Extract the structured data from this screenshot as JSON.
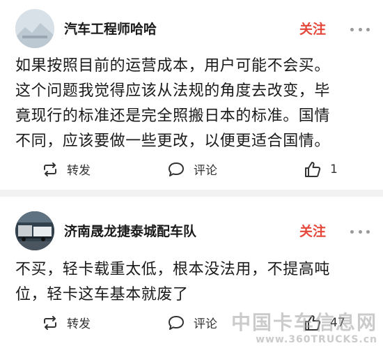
{
  "posts": [
    {
      "username": "汽车工程师哈哈",
      "follow_label": "关注",
      "body_lines": [
        "如果按照目前的运营成本，用户可能不会买。",
        "这个问题我觉得应该从法规的角度去改变，毕",
        "竟现行的标准还是完全照搬日本的标准。国情",
        "不同，应该要做一些更改，以便更适合国情。"
      ],
      "repost_label": "转发",
      "comment_label": "评论",
      "like_count": "1"
    },
    {
      "username": "济南晟龙捷泰城配车队",
      "follow_label": "关注",
      "body_lines": [
        "不买，轻卡载重太低，根本没法用，不提高吨",
        "位，轻卡这车基本就废了"
      ],
      "repost_label": "转发",
      "comment_label": "评论",
      "like_count": "47"
    }
  ],
  "watermark": {
    "cn": "中国卡车信息网",
    "en": "www.360TRUCKS.cn"
  },
  "colors": {
    "follow": "#e5473a",
    "separator": "#f2f2f2"
  },
  "icons": [
    "avatar",
    "more-dots-icon",
    "repost-icon",
    "comment-icon",
    "like-icon"
  ]
}
